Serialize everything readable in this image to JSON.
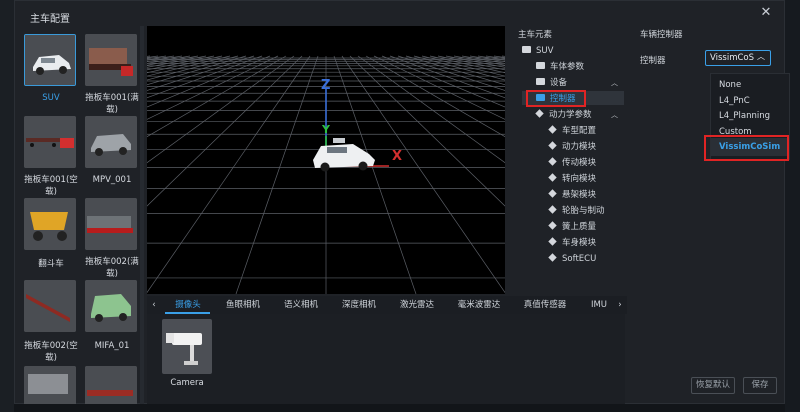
{
  "dialog": {
    "title": "主车配置",
    "close_label": "✕"
  },
  "vehicles": [
    {
      "label": "SUV",
      "selected": true
    },
    {
      "label": "拖板车001(满载)",
      "selected": false
    },
    {
      "label": "拖板车001(空载)",
      "selected": false
    },
    {
      "label": "MPV_001",
      "selected": false
    },
    {
      "label": "翻斗车",
      "selected": false
    },
    {
      "label": "拖板车002(满载)",
      "selected": false
    },
    {
      "label": "拖板车002(空载)",
      "selected": false
    },
    {
      "label": "MIFA_01",
      "selected": false
    }
  ],
  "viewport": {
    "axis_x": "X",
    "axis_y": "Y",
    "axis_z": "Z"
  },
  "sensor_tabs": {
    "prev": "‹",
    "next": "›",
    "items": [
      "摄像头",
      "鱼眼相机",
      "语义相机",
      "深度相机",
      "激光雷达",
      "毫米波雷达",
      "真值传感器",
      "IMU"
    ],
    "active": "摄像头"
  },
  "sensor_items": [
    {
      "label": "Camera"
    }
  ],
  "tree": {
    "title": "主车元素",
    "root": "SUV",
    "nodes": [
      "车体参数",
      "设备",
      "控制器",
      "动力学参数"
    ],
    "dynamics_children": [
      "车型配置",
      "动力模块",
      "传动模块",
      "转向模块",
      "悬架模块",
      "轮胎与制动",
      "簧上质量",
      "车身模块",
      "SoftECU"
    ],
    "selected": "控制器"
  },
  "controller": {
    "title": "车辆控制器",
    "label": "控制器",
    "value": "VissimCoS",
    "options": [
      "None",
      "L4_PnC",
      "L4_Planning",
      "Custom",
      "VissimCoSim"
    ],
    "selected_option": "VissimCoSim"
  },
  "buttons": {
    "restore": "恢复默认",
    "save": "保存"
  },
  "colors": {
    "accent": "#3aa0e8",
    "highlight": "#e02424",
    "dialog_bg": "#1f2227",
    "viewport_bg": "#000000"
  }
}
